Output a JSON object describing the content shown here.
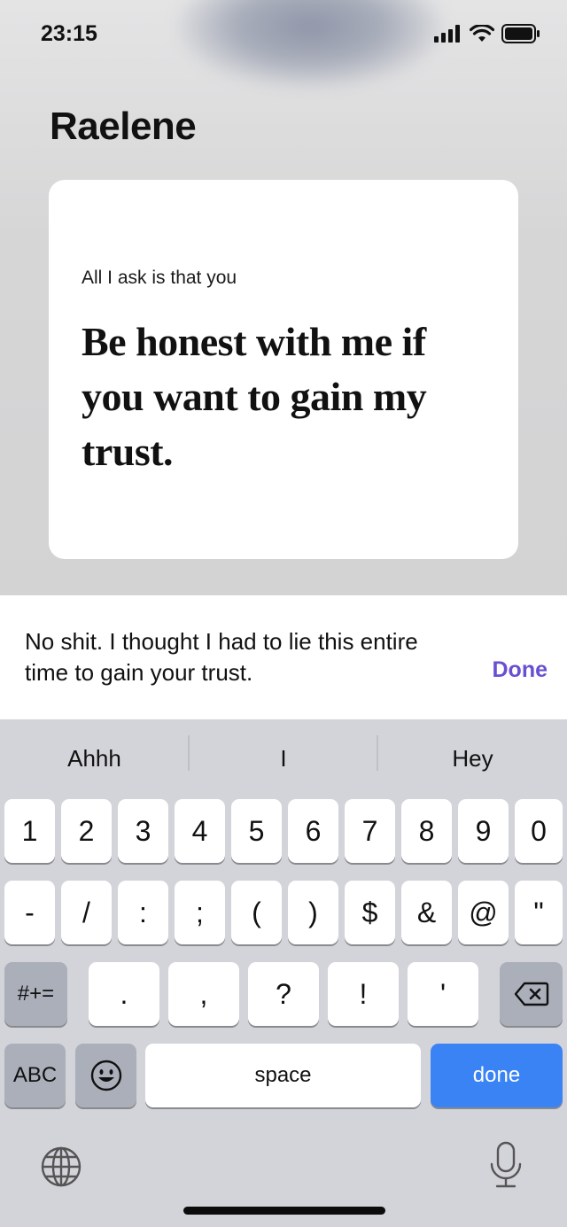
{
  "status_bar": {
    "time": "23:15"
  },
  "header": {
    "contact_name": "Raelene"
  },
  "card": {
    "prompt": "All I ask is that you",
    "answer": "Be honest with me if you want to gain my trust."
  },
  "reply": {
    "text": "No shit.  I thought I had to lie this entire time to gain your trust.",
    "done_label": "Done",
    "accent_color": "#6a4fd2"
  },
  "keyboard": {
    "suggestions": [
      "Ahhh",
      "I",
      "Hey"
    ],
    "row1": [
      "1",
      "2",
      "3",
      "4",
      "5",
      "6",
      "7",
      "8",
      "9",
      "0"
    ],
    "row2": [
      "-",
      "/",
      ":",
      ";",
      "(",
      ")",
      "$",
      "&",
      "@",
      "\""
    ],
    "row3": {
      "shift_label": "#+=",
      "keys": [
        ".",
        ",",
        "?",
        "!",
        "'"
      ],
      "delete_icon": "backspace-icon"
    },
    "row4": {
      "abc_label": "ABC",
      "emoji_icon": "emoji-icon",
      "space_label": "space",
      "done_label": "done",
      "done_color": "#3a83f5"
    },
    "globe_icon": "globe-icon",
    "mic_icon": "microphone-icon"
  }
}
